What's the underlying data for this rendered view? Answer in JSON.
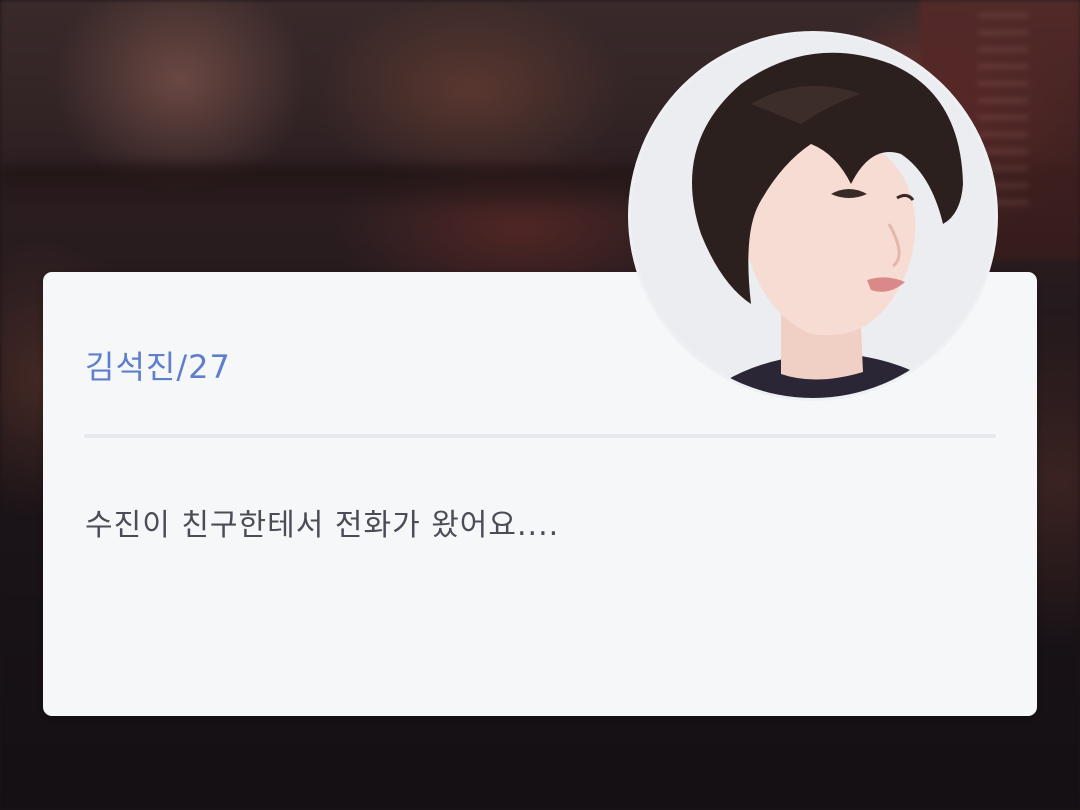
{
  "scene": {
    "character": {
      "name_label": "김석진/27"
    },
    "dialogue": {
      "text": "수진이 친구한테서 전화가 왔어요...."
    },
    "portrait": {
      "icon": "character-portrait"
    }
  },
  "colors": {
    "name_accent": "#5e80cc",
    "dialogue_text": "#4a4d57",
    "card_background": "#f6f7f9",
    "divider": "#e5e8ee"
  }
}
